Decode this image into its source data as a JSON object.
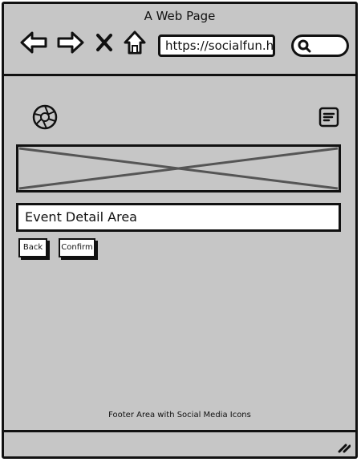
{
  "window": {
    "title": "A Web Page"
  },
  "toolbar": {
    "back_icon": "arrow-left-icon",
    "forward_icon": "arrow-right-icon",
    "stop_icon": "close-icon",
    "home_icon": "home-icon",
    "url": "https://socialfun.h",
    "search_icon": "search-icon"
  },
  "page": {
    "logo_icon": "aperture-icon",
    "menu_icon": "document-menu-icon",
    "banner": "image-placeholder",
    "event_detail": "Event Detail Area",
    "buttons": {
      "back": "Back",
      "confirm": "Confirm"
    },
    "footer": "Footer Area with Social Media Icons"
  },
  "colors": {
    "chrome": "#c6c6c6",
    "stroke": "#111111",
    "placeholder_lines": "#555555"
  }
}
